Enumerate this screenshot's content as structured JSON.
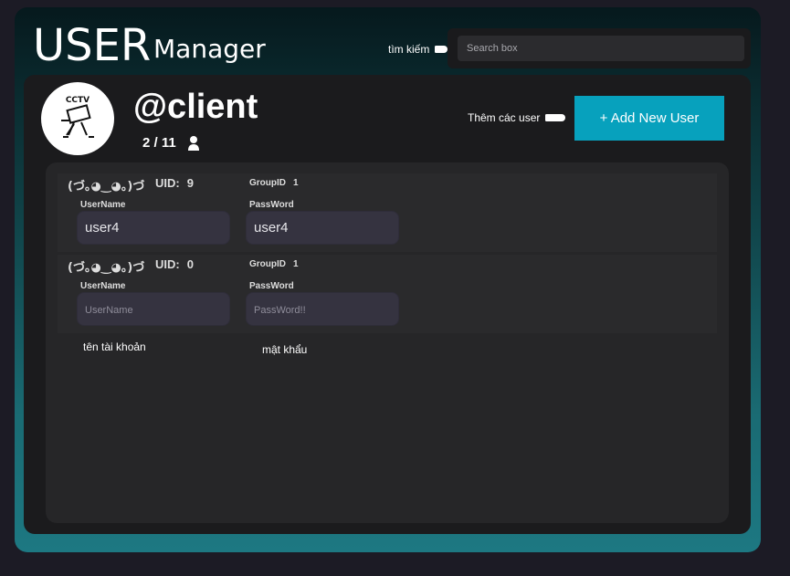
{
  "header": {
    "title_big": "USER",
    "title_small": "Manager"
  },
  "search": {
    "note": "tìm kiếm",
    "placeholder": "Search box"
  },
  "profile": {
    "avatar_text": "CCTV",
    "client_name": "@client",
    "count": "2 / 11",
    "add_note": "Thêm các user",
    "add_button": "+ Add New User"
  },
  "users": [
    {
      "face": "(づ｡◕‿◕｡)づ",
      "uid_label": "UID:",
      "uid": "9",
      "group_label": "GroupID",
      "group_id": "1",
      "username_label": "UserName",
      "username_value": "user4",
      "username_placeholder": "UserName",
      "password_label": "PassWord",
      "password_value": "user4",
      "password_placeholder": "PassWord!!"
    },
    {
      "face": "(づ｡◕‿◕｡)づ",
      "uid_label": "UID:",
      "uid": "0",
      "group_label": "GroupID",
      "group_id": "1",
      "username_label": "UserName",
      "username_value": "",
      "username_placeholder": "UserName",
      "password_label": "PassWord",
      "password_value": "",
      "password_placeholder": "PassWord!!"
    }
  ],
  "notes": {
    "account": "tên tài khoản",
    "password": "mật khẩu"
  }
}
